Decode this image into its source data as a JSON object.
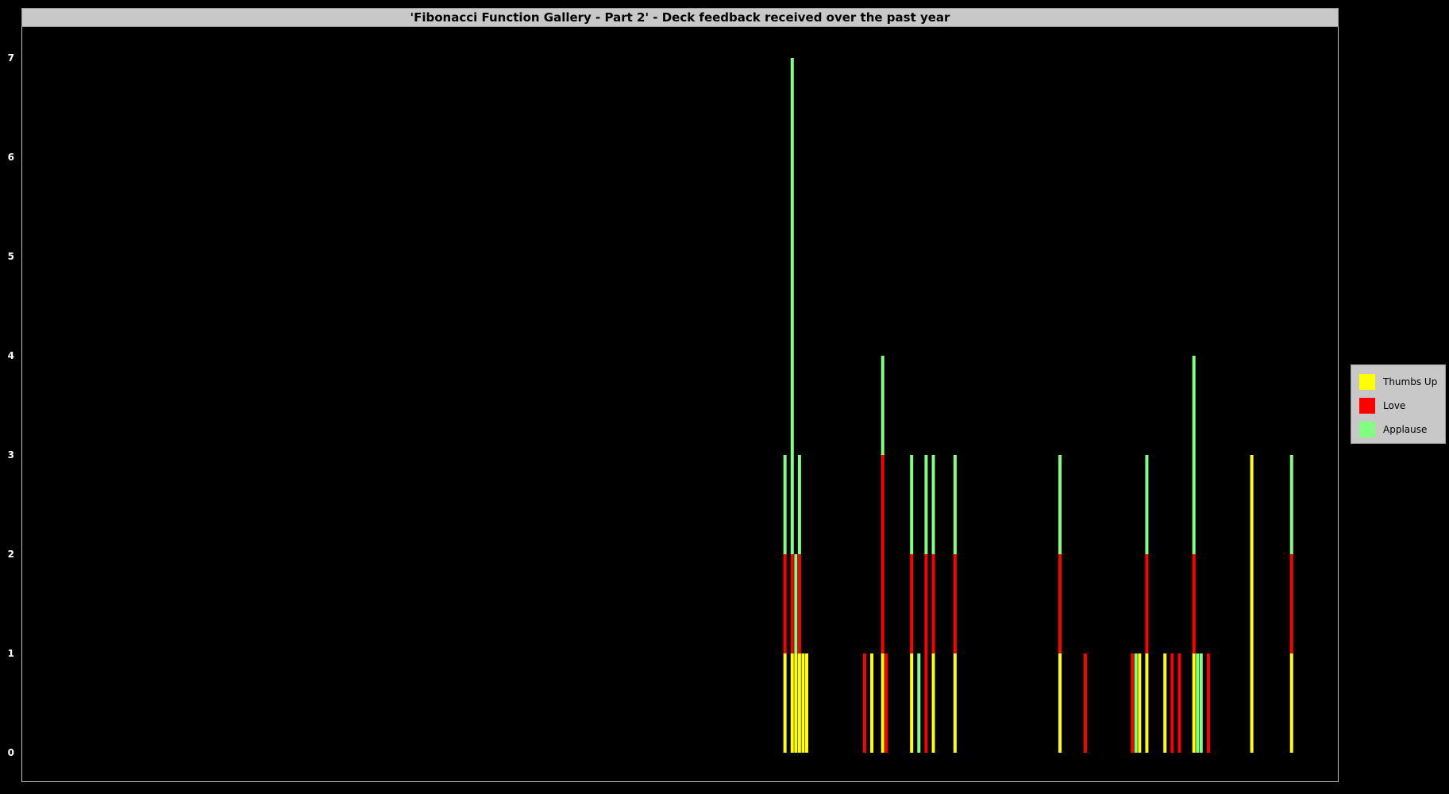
{
  "chart_data": {
    "type": "bar",
    "stacked": true,
    "title": "'Fibonacci Function Gallery - Part 2' - Deck feedback received over the past year",
    "xlabel": "",
    "ylabel": "",
    "ylim": [
      0,
      7
    ],
    "yticks": [
      0,
      1,
      2,
      3,
      4,
      5,
      6,
      7
    ],
    "grid": false,
    "legend_position": "right",
    "background": "#000000",
    "colors": {
      "Thumbs Up": "#ffff00",
      "Love": "#ff0000",
      "Applause": "#80ff80"
    },
    "x_unit": "day index (1-365)",
    "x": [
      212,
      214,
      215,
      216,
      217,
      218,
      234,
      236,
      239,
      240,
      247,
      249,
      251,
      253,
      259,
      288,
      295,
      308,
      309,
      310,
      312,
      317,
      319,
      321,
      325,
      326,
      327,
      329,
      341,
      352
    ],
    "series": [
      {
        "name": "Thumbs Up",
        "values": [
          1,
          1,
          1,
          1,
          1,
          1,
          0,
          1,
          1,
          0,
          1,
          0,
          0,
          1,
          1,
          1,
          0,
          0,
          0,
          1,
          1,
          1,
          0,
          0,
          1,
          0,
          0,
          0,
          3,
          1
        ]
      },
      {
        "name": "Love",
        "values": [
          1,
          1,
          0,
          1,
          0,
          0,
          1,
          0,
          2,
          1,
          1,
          0,
          2,
          1,
          1,
          1,
          1,
          1,
          0,
          0,
          1,
          0,
          1,
          1,
          1,
          0,
          0,
          1,
          0,
          1
        ]
      },
      {
        "name": "Applause",
        "values": [
          1,
          5,
          1,
          1,
          0,
          0,
          0,
          0,
          1,
          0,
          1,
          1,
          1,
          1,
          1,
          1,
          0,
          0,
          1,
          0,
          1,
          0,
          0,
          0,
          2,
          1,
          1,
          0,
          0,
          1
        ]
      }
    ]
  }
}
